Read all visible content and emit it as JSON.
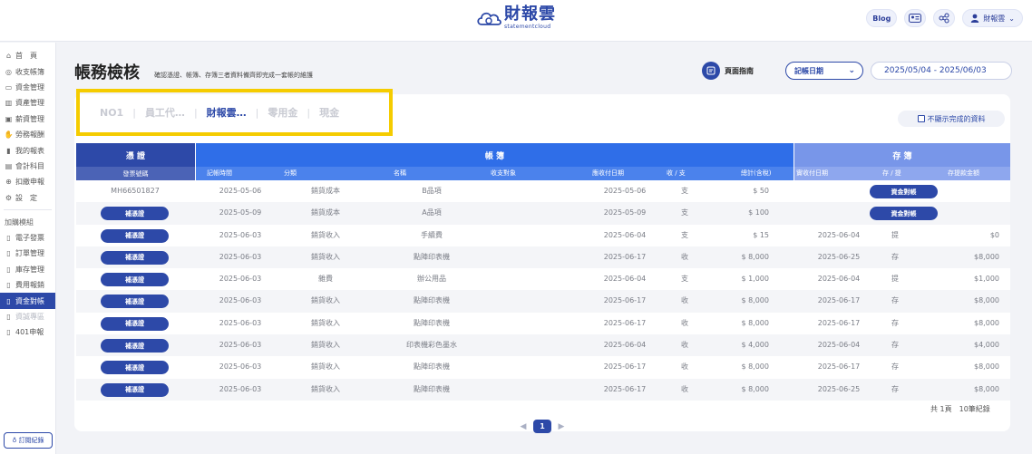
{
  "header": {
    "logo_title": "財報雲",
    "logo_sub": "statementcloud",
    "blog_label": "Blog",
    "user_label": "財報雲"
  },
  "sidebar": {
    "items": [
      {
        "label": "首　頁",
        "icon": "home-icon"
      },
      {
        "label": "收支帳簿",
        "icon": "coin-icon"
      },
      {
        "label": "資金管理",
        "icon": "wallet-icon"
      },
      {
        "label": "資產管理",
        "icon": "building-icon"
      },
      {
        "label": "薪資管理",
        "icon": "id-card-icon"
      },
      {
        "label": "勞務報酬",
        "icon": "hand-icon"
      },
      {
        "label": "我的報表",
        "icon": "bar-chart-icon"
      },
      {
        "label": "會計科目",
        "icon": "ledger-icon"
      },
      {
        "label": "扣繳申報",
        "icon": "stamp-icon"
      },
      {
        "label": "設　定",
        "icon": "gear-icon"
      }
    ],
    "addon_title": "加購模組",
    "addons": [
      {
        "label": "電子發票",
        "state": "normal"
      },
      {
        "label": "訂單管理",
        "state": "normal"
      },
      {
        "label": "庫存管理",
        "state": "normal"
      },
      {
        "label": "費用報銷",
        "state": "normal"
      },
      {
        "label": "資金對帳",
        "state": "active"
      },
      {
        "label": "資誠專區",
        "state": "disabled"
      },
      {
        "label": "401申報",
        "state": "normal"
      }
    ],
    "order_log_label": "訂閱紀錄"
  },
  "main": {
    "title": "帳務檢核",
    "subtitle": "確認憑證、帳簿、存簿三者資料備齊即完成一套帳的維護",
    "guide_label": "頁面指南",
    "date_type": "記帳日期",
    "date_range": "2025/05/04 - 2025/06/03",
    "tabs": [
      "NO1",
      "員工代…",
      "財報雲…",
      "零用金",
      "現金"
    ],
    "active_tab_index": 2,
    "hide_done_label": "不顯示完成的資料"
  },
  "table": {
    "group_voucher": "憑 證",
    "group_ledger": "帳 簿",
    "group_bank": "存 簿",
    "col_invoice": "發票號碼",
    "col_date": "記帳時間",
    "col_category": "分類",
    "col_name": "名稱",
    "col_counterparty": "收支對象",
    "col_due": "應收付日期",
    "col_io": "收 / 支",
    "col_total": "總計(含稅)",
    "col_actual": "實收付日期",
    "col_dw": "存 / 提",
    "col_amount": "存提款金額",
    "fill_label": "補憑證",
    "match_label": "資金對帳",
    "rows": [
      {
        "invoice": "MH66501827",
        "date": "2025-05-06",
        "category": "銷貨成本",
        "name": "B品項",
        "party": "",
        "due": "2025-05-06",
        "io": "支",
        "total": "$ 50",
        "actual": "",
        "dw": "",
        "amount": "",
        "match": true
      },
      {
        "invoice": "",
        "date": "2025-05-09",
        "category": "銷貨成本",
        "name": "A品項",
        "party": "",
        "due": "2025-05-09",
        "io": "支",
        "total": "$ 100",
        "actual": "",
        "dw": "",
        "amount": "",
        "match": true
      },
      {
        "invoice": "",
        "date": "2025-06-03",
        "category": "銷貨收入",
        "name": "手續費",
        "party": "",
        "due": "2025-06-04",
        "io": "支",
        "total": "$ 15",
        "actual": "2025-06-04",
        "dw": "提",
        "amount": "$0",
        "match": false
      },
      {
        "invoice": "",
        "date": "2025-06-03",
        "category": "銷貨收入",
        "name": "點陣印表機",
        "party": "",
        "due": "2025-06-17",
        "io": "收",
        "total": "$ 8,000",
        "actual": "2025-06-25",
        "dw": "存",
        "amount": "$8,000",
        "match": false
      },
      {
        "invoice": "",
        "date": "2025-06-03",
        "category": "雜費",
        "name": "辦公用品",
        "party": "",
        "due": "2025-06-04",
        "io": "支",
        "total": "$ 1,000",
        "actual": "2025-06-04",
        "dw": "提",
        "amount": "$1,000",
        "match": false
      },
      {
        "invoice": "",
        "date": "2025-06-03",
        "category": "銷貨收入",
        "name": "點陣印表機",
        "party": "",
        "due": "2025-06-17",
        "io": "收",
        "total": "$ 8,000",
        "actual": "2025-06-17",
        "dw": "存",
        "amount": "$8,000",
        "match": false
      },
      {
        "invoice": "",
        "date": "2025-06-03",
        "category": "銷貨收入",
        "name": "點陣印表機",
        "party": "",
        "due": "2025-06-17",
        "io": "收",
        "total": "$ 8,000",
        "actual": "2025-06-17",
        "dw": "存",
        "amount": "$8,000",
        "match": false
      },
      {
        "invoice": "",
        "date": "2025-06-03",
        "category": "銷貨收入",
        "name": "印表機彩色墨水",
        "party": "",
        "due": "2025-06-04",
        "io": "收",
        "total": "$ 4,000",
        "actual": "2025-06-04",
        "dw": "存",
        "amount": "$4,000",
        "match": false
      },
      {
        "invoice": "",
        "date": "2025-06-03",
        "category": "銷貨收入",
        "name": "點陣印表機",
        "party": "",
        "due": "2025-06-17",
        "io": "收",
        "total": "$ 8,000",
        "actual": "2025-06-17",
        "dw": "存",
        "amount": "$8,000",
        "match": false
      },
      {
        "invoice": "",
        "date": "2025-06-03",
        "category": "銷貨收入",
        "name": "點陣印表機",
        "party": "",
        "due": "2025-06-17",
        "io": "收",
        "total": "$ 8,000",
        "actual": "2025-06-25",
        "dw": "存",
        "amount": "$8,000",
        "match": false
      }
    ]
  },
  "footer": {
    "summary": "共 1頁　10筆紀錄",
    "current_page": "1"
  },
  "colors": {
    "primary": "#2d49a8",
    "ledger_blue": "#2f6ee8",
    "bank_blue": "#7896e9",
    "highlight": "#f5cc00"
  }
}
